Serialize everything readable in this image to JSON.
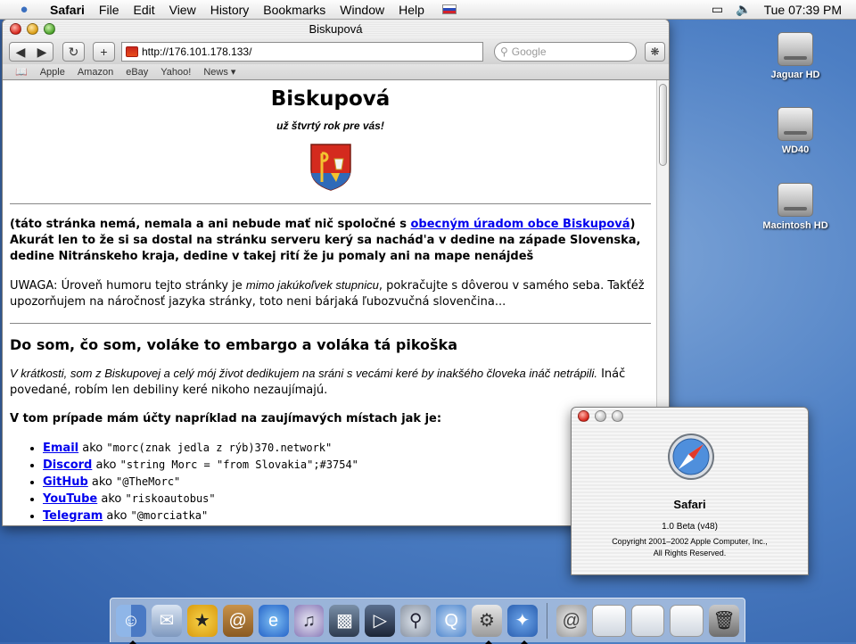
{
  "menubar": {
    "apple": "",
    "app": "Safari",
    "menus": [
      "File",
      "Edit",
      "View",
      "History",
      "Bookmarks",
      "Window",
      "Help"
    ],
    "clock": "Tue 07:39 PM"
  },
  "desktop": {
    "disks": [
      "Jaguar HD",
      "WD40",
      "Macintosh HD"
    ]
  },
  "browser": {
    "title": "Biskupová",
    "url": "http://176.101.178.133/",
    "search_placeholder": "Google",
    "bookmarks": [
      "Apple",
      "Amazon",
      "eBay",
      "Yahoo!",
      "News ▾"
    ]
  },
  "page": {
    "heading": "Biskupová",
    "motto": "už štvrtý rok pre vás!",
    "disclaimer_pre": "(táto stránka nemá, nemala a ani nebude mať nič spoločné s ",
    "disclaimer_link": "obecným úradom obce Biskupová",
    "disclaimer_post": ")",
    "intro": "Akurát len to že si sa dostal na stránku serveru kerý sa nachád'a v dedine na západe Slovenska, dedine Nitránskeho kraja, dedine v takej rití že ju pomaly ani na mape nenájdeš",
    "warning_pre": "UWAGA: Úroveň humoru tejto stránky je ",
    "warning_em": "mimo jakúkoľvek stupnicu",
    "warning_post": ", pokračujte s dôverou v samého seba. Takťéž upozorňujem na náročnosť jazyka stránky, toto neni bárjaká ľubozvučná slovenčina...",
    "section_title": "Do som, čo som, voláke to embargo a voláka tá pikoška",
    "about_em": "V krátkosti, som z Biskupovej a celý mój život dedikujem na sráni s vecámi keré by inakšého človeka ináč netrápili.",
    "about_post": " Ináč povedané, robím len debiliny keré nikoho nezaujímajú.",
    "accounts_title": "V tom prípade mám účty napríklad na zaujímavých místach jak je:",
    "accounts": [
      {
        "name": "Email",
        "sep": " ako ",
        "value": "\"morc(znak jedla z rýb)370.network\""
      },
      {
        "name": "Discord",
        "sep": " ako ",
        "value": "\"string Morc = \"from Slovakia\";#3754\""
      },
      {
        "name": "GitHub",
        "sep": " ako ",
        "value": "\"@TheMorc\""
      },
      {
        "name": "YouTube",
        "sep": " ako ",
        "value": "\"riskoautobus\""
      },
      {
        "name": "Telegram",
        "sep": " ako ",
        "value": "\"@morciatka\""
      }
    ]
  },
  "about": {
    "name": "Safari",
    "version": "1.0 Beta (v48)",
    "copyright": "Copyright 2001–2002 Apple Computer, Inc.,",
    "rights": "All Rights Reserved."
  },
  "dock": {
    "apps": [
      "finder-icon",
      "mail-icon",
      "aim-icon",
      "address-book-icon",
      "internet-explorer-icon",
      "itunes-icon",
      "iphoto-icon",
      "imovie-icon",
      "sherlock-icon",
      "quicktime-icon",
      "system-preferences-icon",
      "safari-icon",
      "network-icon",
      "window-thumbnail",
      "window-thumbnail",
      "window-thumbnail",
      "trash-icon"
    ]
  }
}
